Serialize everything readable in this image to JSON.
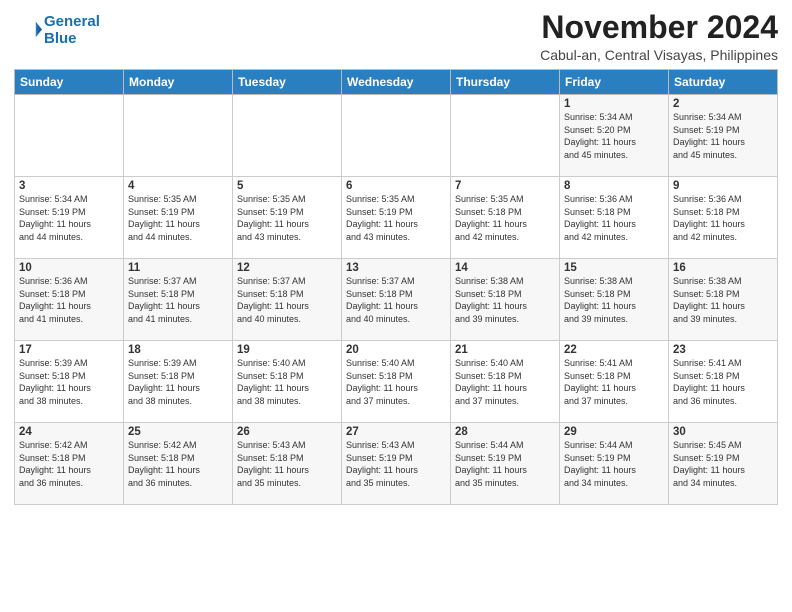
{
  "header": {
    "logo_line1": "General",
    "logo_line2": "Blue",
    "month": "November 2024",
    "location": "Cabul-an, Central Visayas, Philippines"
  },
  "weekdays": [
    "Sunday",
    "Monday",
    "Tuesday",
    "Wednesday",
    "Thursday",
    "Friday",
    "Saturday"
  ],
  "rows": [
    [
      {
        "day": "",
        "info": ""
      },
      {
        "day": "",
        "info": ""
      },
      {
        "day": "",
        "info": ""
      },
      {
        "day": "",
        "info": ""
      },
      {
        "day": "",
        "info": ""
      },
      {
        "day": "1",
        "info": "Sunrise: 5:34 AM\nSunset: 5:20 PM\nDaylight: 11 hours\nand 45 minutes."
      },
      {
        "day": "2",
        "info": "Sunrise: 5:34 AM\nSunset: 5:19 PM\nDaylight: 11 hours\nand 45 minutes."
      }
    ],
    [
      {
        "day": "3",
        "info": "Sunrise: 5:34 AM\nSunset: 5:19 PM\nDaylight: 11 hours\nand 44 minutes."
      },
      {
        "day": "4",
        "info": "Sunrise: 5:35 AM\nSunset: 5:19 PM\nDaylight: 11 hours\nand 44 minutes."
      },
      {
        "day": "5",
        "info": "Sunrise: 5:35 AM\nSunset: 5:19 PM\nDaylight: 11 hours\nand 43 minutes."
      },
      {
        "day": "6",
        "info": "Sunrise: 5:35 AM\nSunset: 5:19 PM\nDaylight: 11 hours\nand 43 minutes."
      },
      {
        "day": "7",
        "info": "Sunrise: 5:35 AM\nSunset: 5:18 PM\nDaylight: 11 hours\nand 42 minutes."
      },
      {
        "day": "8",
        "info": "Sunrise: 5:36 AM\nSunset: 5:18 PM\nDaylight: 11 hours\nand 42 minutes."
      },
      {
        "day": "9",
        "info": "Sunrise: 5:36 AM\nSunset: 5:18 PM\nDaylight: 11 hours\nand 42 minutes."
      }
    ],
    [
      {
        "day": "10",
        "info": "Sunrise: 5:36 AM\nSunset: 5:18 PM\nDaylight: 11 hours\nand 41 minutes."
      },
      {
        "day": "11",
        "info": "Sunrise: 5:37 AM\nSunset: 5:18 PM\nDaylight: 11 hours\nand 41 minutes."
      },
      {
        "day": "12",
        "info": "Sunrise: 5:37 AM\nSunset: 5:18 PM\nDaylight: 11 hours\nand 40 minutes."
      },
      {
        "day": "13",
        "info": "Sunrise: 5:37 AM\nSunset: 5:18 PM\nDaylight: 11 hours\nand 40 minutes."
      },
      {
        "day": "14",
        "info": "Sunrise: 5:38 AM\nSunset: 5:18 PM\nDaylight: 11 hours\nand 39 minutes."
      },
      {
        "day": "15",
        "info": "Sunrise: 5:38 AM\nSunset: 5:18 PM\nDaylight: 11 hours\nand 39 minutes."
      },
      {
        "day": "16",
        "info": "Sunrise: 5:38 AM\nSunset: 5:18 PM\nDaylight: 11 hours\nand 39 minutes."
      }
    ],
    [
      {
        "day": "17",
        "info": "Sunrise: 5:39 AM\nSunset: 5:18 PM\nDaylight: 11 hours\nand 38 minutes."
      },
      {
        "day": "18",
        "info": "Sunrise: 5:39 AM\nSunset: 5:18 PM\nDaylight: 11 hours\nand 38 minutes."
      },
      {
        "day": "19",
        "info": "Sunrise: 5:40 AM\nSunset: 5:18 PM\nDaylight: 11 hours\nand 38 minutes."
      },
      {
        "day": "20",
        "info": "Sunrise: 5:40 AM\nSunset: 5:18 PM\nDaylight: 11 hours\nand 37 minutes."
      },
      {
        "day": "21",
        "info": "Sunrise: 5:40 AM\nSunset: 5:18 PM\nDaylight: 11 hours\nand 37 minutes."
      },
      {
        "day": "22",
        "info": "Sunrise: 5:41 AM\nSunset: 5:18 PM\nDaylight: 11 hours\nand 37 minutes."
      },
      {
        "day": "23",
        "info": "Sunrise: 5:41 AM\nSunset: 5:18 PM\nDaylight: 11 hours\nand 36 minutes."
      }
    ],
    [
      {
        "day": "24",
        "info": "Sunrise: 5:42 AM\nSunset: 5:18 PM\nDaylight: 11 hours\nand 36 minutes."
      },
      {
        "day": "25",
        "info": "Sunrise: 5:42 AM\nSunset: 5:18 PM\nDaylight: 11 hours\nand 36 minutes."
      },
      {
        "day": "26",
        "info": "Sunrise: 5:43 AM\nSunset: 5:18 PM\nDaylight: 11 hours\nand 35 minutes."
      },
      {
        "day": "27",
        "info": "Sunrise: 5:43 AM\nSunset: 5:19 PM\nDaylight: 11 hours\nand 35 minutes."
      },
      {
        "day": "28",
        "info": "Sunrise: 5:44 AM\nSunset: 5:19 PM\nDaylight: 11 hours\nand 35 minutes."
      },
      {
        "day": "29",
        "info": "Sunrise: 5:44 AM\nSunset: 5:19 PM\nDaylight: 11 hours\nand 34 minutes."
      },
      {
        "day": "30",
        "info": "Sunrise: 5:45 AM\nSunset: 5:19 PM\nDaylight: 11 hours\nand 34 minutes."
      }
    ]
  ]
}
